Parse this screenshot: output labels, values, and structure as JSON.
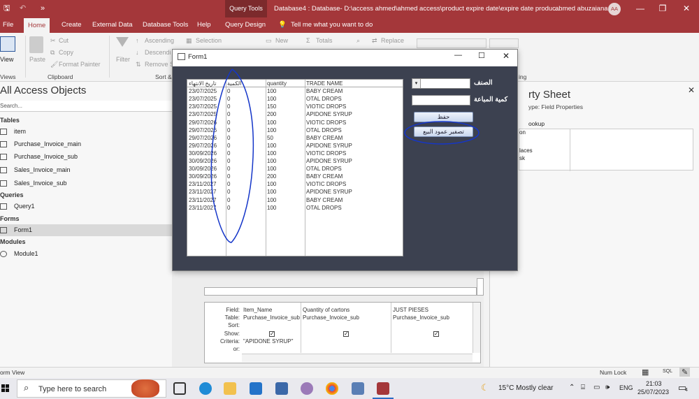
{
  "app": {
    "context_tab": "Query Tools",
    "window_title": "Database4 : Database- D:\\access ahmed\\ahmed access\\product expire date\\expire date produc...",
    "user_name": "ahmed abuzaiana",
    "user_initials": "AA",
    "minimize": "—",
    "restore": "❐",
    "close": "✕"
  },
  "ribbon": {
    "tabs": [
      "File",
      "Home",
      "Create",
      "External Data",
      "Database Tools",
      "Help",
      "Query Design"
    ],
    "tell_me": "Tell me what you want to do",
    "buttons": {
      "view": "View",
      "paste": "Paste",
      "cut": "Cut",
      "copy": "Copy",
      "format_painter": "Format Painter",
      "filter": "Filter",
      "ascending": "Ascending",
      "descending": "Descendi",
      "remove_sort": "Remove S",
      "selection": "Selection",
      "new": "New",
      "totals": "Totals",
      "replace": "Replace"
    },
    "groups": {
      "views": "Views",
      "clipboard": "Clipboard",
      "sort": "Sort &",
      "ing": "ing"
    }
  },
  "nav": {
    "header": "All Access Objects",
    "search_placeholder": "Search...",
    "sections": {
      "tables": "Tables",
      "queries": "Queries",
      "forms": "Forms",
      "modules": "Modules"
    },
    "tables": [
      "item",
      "Purchase_Invoice_main",
      "Purchase_Invoice_sub",
      "Sales_Invoice_main",
      "Sales_Invoice_sub"
    ],
    "queries": [
      "Query1"
    ],
    "forms": [
      "Form1"
    ],
    "modules": [
      "Module1"
    ]
  },
  "form": {
    "title": "Form1",
    "list_headers": [
      "تاريخ الانتهاء",
      "الكمية",
      "quantity",
      "TRADE NAME"
    ],
    "rows": [
      [
        "23/07/2025",
        "0",
        "100",
        "BABY CREAM"
      ],
      [
        "23/07/2025",
        "0",
        "100",
        "OTAL DROPS"
      ],
      [
        "23/07/2025",
        "0",
        "150",
        "VIOTIC DROPS"
      ],
      [
        "23/07/2025",
        "0",
        "200",
        "APIDONE SYRUP"
      ],
      [
        "29/07/2026",
        "0",
        "100",
        "VIOTIC DROPS"
      ],
      [
        "29/07/2026",
        "0",
        "100",
        "OTAL DROPS"
      ],
      [
        "29/07/2026",
        "0",
        "50",
        "BABY CREAM"
      ],
      [
        "29/07/2026",
        "0",
        "100",
        "APIDONE SYRUP"
      ],
      [
        "30/09/2026",
        "0",
        "100",
        "VIOTIC DROPS"
      ],
      [
        "30/09/2026",
        "0",
        "100",
        "APIDONE SYRUP"
      ],
      [
        "30/09/2026",
        "0",
        "100",
        "OTAL DROPS"
      ],
      [
        "30/09/2026",
        "0",
        "200",
        "BABY CREAM"
      ],
      [
        "23/11/2027",
        "0",
        "100",
        "VIOTIC DROPS"
      ],
      [
        "23/11/2027",
        "0",
        "100",
        "APIDONE SYRUP"
      ],
      [
        "23/11/2027",
        "0",
        "100",
        "BABY CREAM"
      ],
      [
        "23/11/2027",
        "0",
        "100",
        "OTAL DROPS"
      ]
    ],
    "label_item": "الصنف",
    "label_qty_sold": "كمية المباعة",
    "save_button": "حفظ",
    "reset_button": "تصفير عمود البيع"
  },
  "query_grid": {
    "row_labels": [
      "Field:",
      "Table:",
      "Sort:",
      "Show:",
      "Criteria:",
      "or:"
    ],
    "columns": [
      {
        "field": "Item_Name",
        "table": "Purchase_Invoice_sub",
        "show": true,
        "criteria": "\"APIDONE SYRUP\""
      },
      {
        "field": "Quantity of cartons",
        "table": "Purchase_Invoice_sub",
        "show": true,
        "criteria": ""
      },
      {
        "field": "JUST PIESES",
        "table": "Purchase_Invoice_sub",
        "show": true,
        "criteria": ""
      }
    ]
  },
  "property_sheet": {
    "title": "rty Sheet",
    "type_label": "ype:  Field Properties",
    "tab": "ookup",
    "rows": [
      "on",
      "",
      "laces",
      "sk",
      ""
    ]
  },
  "status": {
    "left": "orm View",
    "num_lock": "Num Lock"
  },
  "taskbar": {
    "search_placeholder": "Type here to search",
    "weather": "15°C  Mostly clear",
    "lang": "ENG",
    "time": "21:03",
    "date": "25/07/2023",
    "notifications": "4"
  }
}
